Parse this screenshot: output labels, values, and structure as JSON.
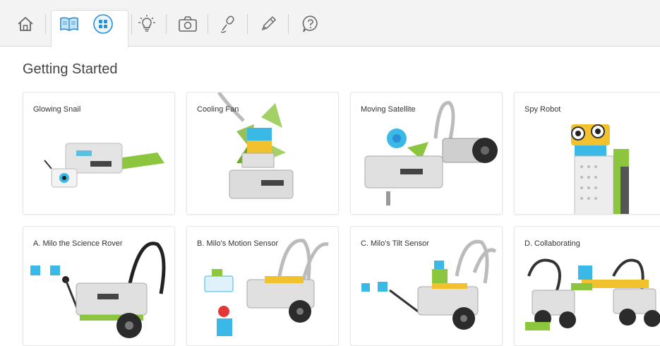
{
  "toolbar": {
    "tabs": [
      {
        "icon": "home-icon"
      },
      {
        "icon": "book-icon"
      },
      {
        "icon": "grid-icon"
      },
      {
        "icon": "lightbulb-icon"
      },
      {
        "icon": "camera-icon"
      },
      {
        "icon": "microphone-icon"
      },
      {
        "icon": "pencil-icon"
      },
      {
        "icon": "help-icon"
      }
    ]
  },
  "page": {
    "title": "Getting Started"
  },
  "projects": [
    {
      "label": "Glowing Snail"
    },
    {
      "label": "Cooling Fan"
    },
    {
      "label": "Moving Satellite"
    },
    {
      "label": "Spy Robot"
    },
    {
      "label": "A. Milo the Science Rover"
    },
    {
      "label": "B. Milo's Motion Sensor"
    },
    {
      "label": "C. Milo's Tilt Sensor"
    },
    {
      "label": "D. Collaborating"
    }
  ],
  "colors": {
    "accent": "#2a8fd6",
    "lego_green": "#8cc63f",
    "lego_blue": "#3bb9e6",
    "lego_grey": "#d8d8d8",
    "lego_dark": "#3a3a3a"
  }
}
